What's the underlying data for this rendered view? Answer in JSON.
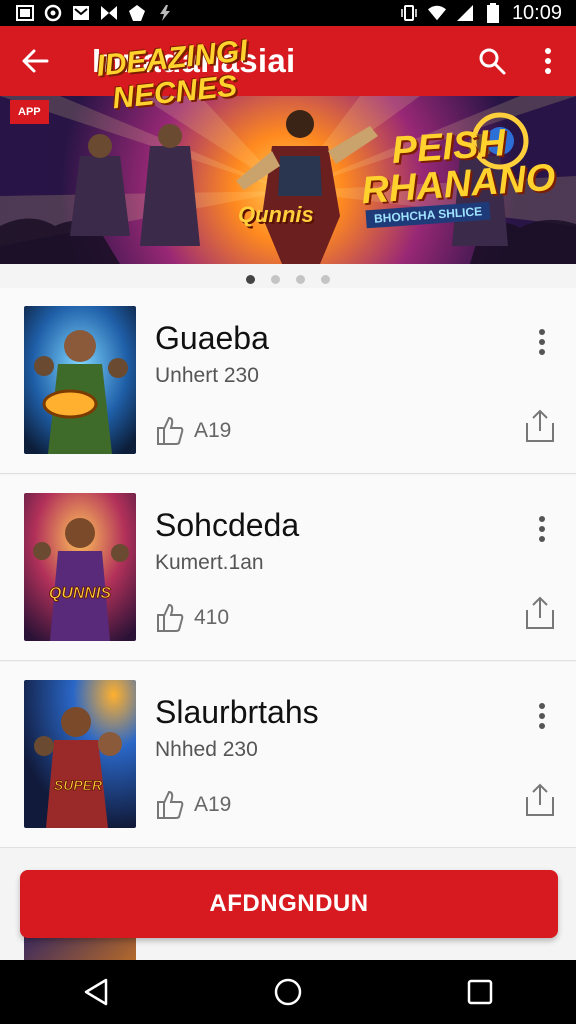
{
  "status_bar": {
    "time": "10:09",
    "left_icons": [
      "image-icon",
      "sync-icon",
      "mail-icon",
      "bowtie-icon",
      "shield-icon",
      "flash-icon"
    ],
    "right_icons": [
      "vibrate-icon",
      "wifi-icon",
      "signal-icon",
      "battery-icon"
    ]
  },
  "app_bar": {
    "title": "Innadanasiai",
    "back_icon": "arrow-left-icon",
    "search_icon": "search-icon",
    "menu_icon": "more-vert-icon"
  },
  "banner": {
    "badge": "APP",
    "title_left": "IDEAZINGI NECNES",
    "title_right": "PEISH RHANANO",
    "subtitle": "BHOHCHA SHLICE",
    "logo": "Qunnis",
    "page_count": 4,
    "active_page": 0
  },
  "items": [
    {
      "title": "Guaeba",
      "subtitle": "Unhert 230",
      "likes": "A19"
    },
    {
      "title": "Sohcdeda",
      "subtitle": "Kumert.1an",
      "likes": "410"
    },
    {
      "title": "Slaurbrtahs",
      "subtitle": "Nhhed 230",
      "likes": "A19"
    }
  ],
  "cta": {
    "label": "AFDNGNDUN"
  },
  "nav_bar": {
    "buttons": [
      "back-triangle-icon",
      "home-circle-icon",
      "recents-square-icon"
    ]
  },
  "colors": {
    "brand": "#d71920",
    "status_bar": "#000000"
  }
}
